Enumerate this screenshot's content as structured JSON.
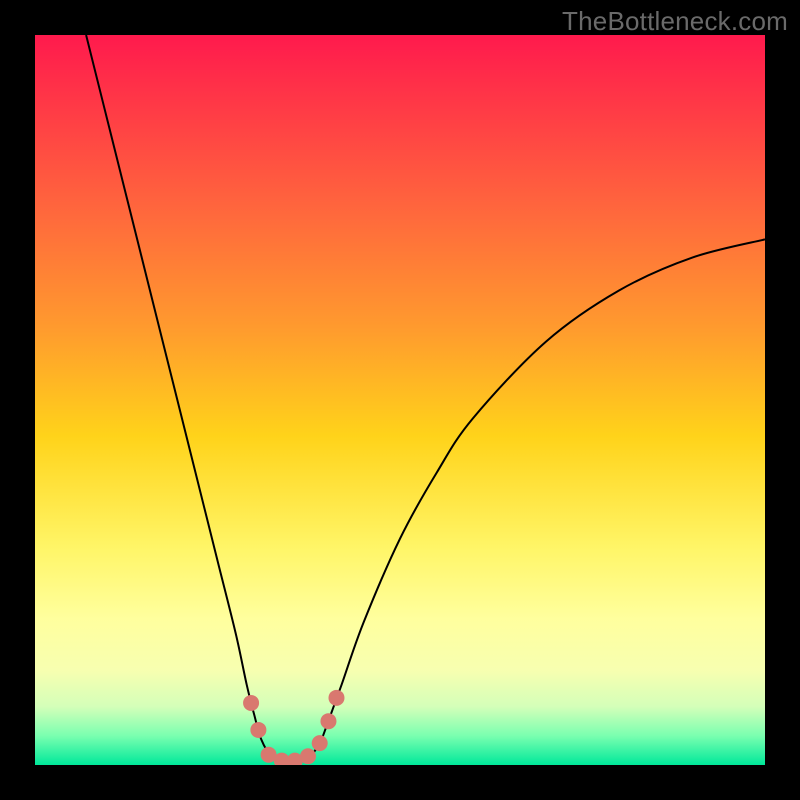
{
  "watermark": "TheBottleneck.com",
  "chart_data": {
    "type": "line",
    "title": "",
    "xlabel": "",
    "ylabel": "",
    "xlim": [
      0,
      100
    ],
    "ylim": [
      0,
      100
    ],
    "grid": false,
    "background_gradient_stops": [
      {
        "offset": 0.0,
        "color": "#ff1a4d"
      },
      {
        "offset": 0.1,
        "color": "#ff3a46"
      },
      {
        "offset": 0.25,
        "color": "#ff6a3c"
      },
      {
        "offset": 0.4,
        "color": "#ff9a2e"
      },
      {
        "offset": 0.55,
        "color": "#ffd31a"
      },
      {
        "offset": 0.7,
        "color": "#fff566"
      },
      {
        "offset": 0.8,
        "color": "#ffff9e"
      },
      {
        "offset": 0.87,
        "color": "#f7ffb0"
      },
      {
        "offset": 0.92,
        "color": "#d4ffb9"
      },
      {
        "offset": 0.96,
        "color": "#7affb0"
      },
      {
        "offset": 1.0,
        "color": "#00e89a"
      }
    ],
    "series": [
      {
        "name": "bottleneck-curve",
        "stroke": "#000000",
        "stroke_width": 2,
        "points": [
          {
            "x": 7.0,
            "y": 100.0
          },
          {
            "x": 10.0,
            "y": 88.0
          },
          {
            "x": 14.0,
            "y": 72.0
          },
          {
            "x": 18.0,
            "y": 56.0
          },
          {
            "x": 22.0,
            "y": 40.0
          },
          {
            "x": 25.0,
            "y": 28.0
          },
          {
            "x": 27.5,
            "y": 18.0
          },
          {
            "x": 29.0,
            "y": 11.0
          },
          {
            "x": 30.0,
            "y": 7.0
          },
          {
            "x": 31.0,
            "y": 3.5
          },
          {
            "x": 32.5,
            "y": 1.0
          },
          {
            "x": 34.0,
            "y": 0.4
          },
          {
            "x": 36.0,
            "y": 0.4
          },
          {
            "x": 37.5,
            "y": 1.0
          },
          {
            "x": 39.0,
            "y": 3.0
          },
          {
            "x": 40.0,
            "y": 5.5
          },
          {
            "x": 42.0,
            "y": 11.0
          },
          {
            "x": 45.0,
            "y": 19.5
          },
          {
            "x": 50.0,
            "y": 31.0
          },
          {
            "x": 55.0,
            "y": 40.0
          },
          {
            "x": 60.0,
            "y": 47.5
          },
          {
            "x": 70.0,
            "y": 58.0
          },
          {
            "x": 80.0,
            "y": 65.0
          },
          {
            "x": 90.0,
            "y": 69.5
          },
          {
            "x": 100.0,
            "y": 72.0
          }
        ]
      }
    ],
    "markers": {
      "name": "trough-markers",
      "color": "#d9786f",
      "radius_px": 8,
      "points": [
        {
          "x": 29.6,
          "y": 8.5
        },
        {
          "x": 30.6,
          "y": 4.8
        },
        {
          "x": 32.0,
          "y": 1.4
        },
        {
          "x": 33.8,
          "y": 0.6
        },
        {
          "x": 35.6,
          "y": 0.6
        },
        {
          "x": 37.4,
          "y": 1.2
        },
        {
          "x": 39.0,
          "y": 3.0
        },
        {
          "x": 40.2,
          "y": 6.0
        },
        {
          "x": 41.3,
          "y": 9.2
        }
      ]
    }
  }
}
